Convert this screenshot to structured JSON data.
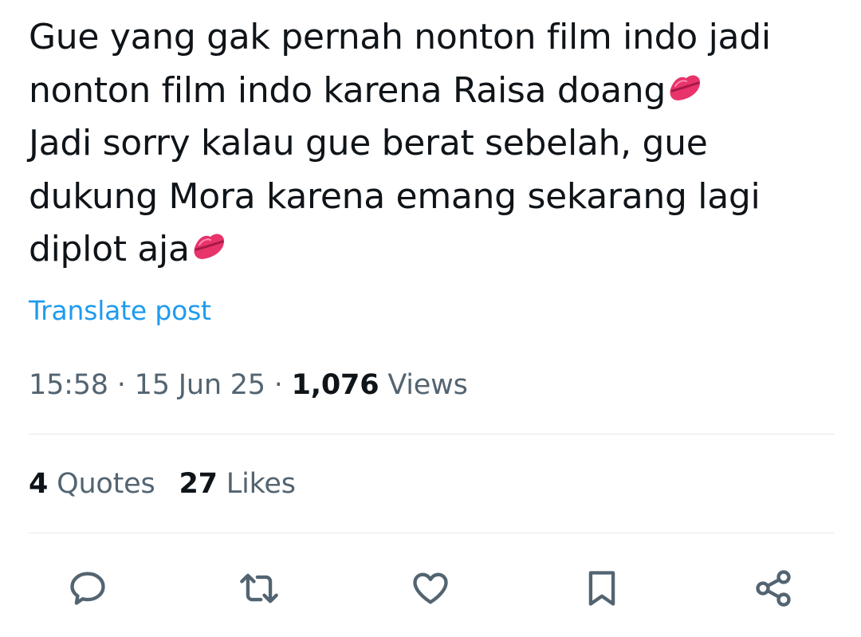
{
  "post": {
    "lines": [
      "Gue yang gak pernah nonton film indo jadi",
      "nonton film indo karena Raisa doang",
      "Jadi sorry kalau gue berat sebelah, gue",
      "dukung Mora karena emang sekarang lagi",
      "diplot aja"
    ],
    "emoji": "kiss-mark-emoji"
  },
  "translate_label": "Translate post",
  "meta": {
    "time": "15:58",
    "separator": " · ",
    "date": "15 Jun 25",
    "views_count": "1,076",
    "views_label": "Views"
  },
  "stats": {
    "quotes_count": "4",
    "quotes_label": "Quotes",
    "likes_count": "27",
    "likes_label": "Likes"
  },
  "actions": [
    "reply-icon",
    "repost-icon",
    "like-icon",
    "bookmark-icon",
    "share-icon"
  ],
  "colors": {
    "text": "#0f1419",
    "secondary": "#536471",
    "link": "#1d9bf0",
    "divider": "#e4e8eb",
    "emoji": "#e8336b"
  }
}
